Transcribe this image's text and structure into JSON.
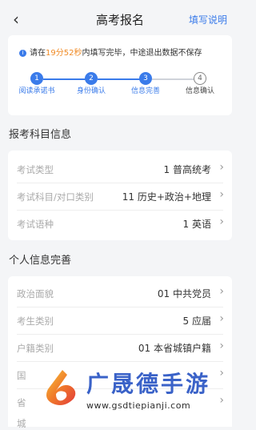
{
  "header": {
    "title": "高考报名",
    "help_label": "填写说明",
    "back_icon": "chevron-left-icon"
  },
  "notice": {
    "prefix": "请在",
    "time": "19分52秒",
    "suffix": "内填写完毕，中途退出数据不保存"
  },
  "steps": [
    {
      "num": "1",
      "label": "阅读承诺书",
      "state": "done"
    },
    {
      "num": "2",
      "label": "身份确认",
      "state": "done"
    },
    {
      "num": "3",
      "label": "信息完善",
      "state": "done"
    },
    {
      "num": "4",
      "label": "信息确认",
      "state": "current"
    }
  ],
  "exam_section": {
    "title": "报考科目信息",
    "rows": [
      {
        "label": "考试类型",
        "value": "1 普高统考"
      },
      {
        "label": "考试科目/对口类别",
        "value": "11 历史+政治+地理"
      },
      {
        "label": "考试语种",
        "value": "1 英语"
      }
    ]
  },
  "personal_section": {
    "title": "个人信息完善",
    "rows": [
      {
        "label": "政治面貌",
        "value": "01 中共党员"
      },
      {
        "label": "考生类别",
        "value": "5 应届"
      },
      {
        "label": "户籍类别",
        "value": "01 本省城镇户籍"
      },
      {
        "label": "国",
        "value": ""
      },
      {
        "label": "省",
        "value": ""
      },
      {
        "label": "城",
        "value": ""
      }
    ]
  },
  "watermark": {
    "text": "广晟德手游",
    "url": "www.gsdtiepianji.com"
  },
  "colors": {
    "accent": "#3a7bea",
    "timer": "#f08a24",
    "background": "#f4f5f7"
  }
}
